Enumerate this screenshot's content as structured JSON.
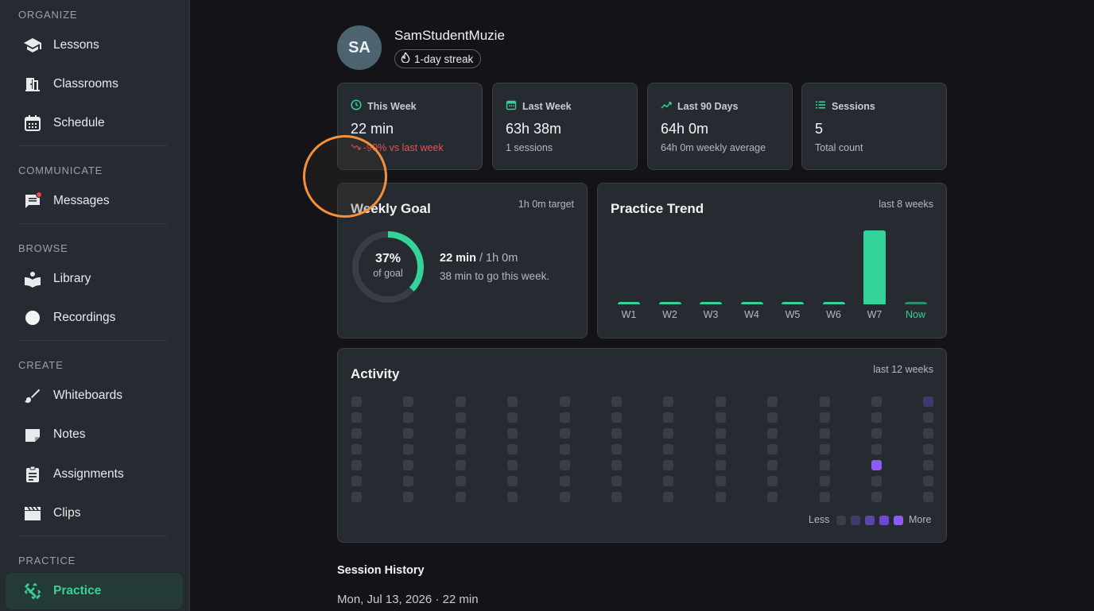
{
  "sidebar": {
    "sections": [
      {
        "title": "ORGANIZE",
        "items": [
          {
            "label": "Lessons",
            "icon": "school-icon"
          },
          {
            "label": "Classrooms",
            "icon": "door-icon"
          },
          {
            "label": "Schedule",
            "icon": "calendar-icon"
          }
        ]
      },
      {
        "title": "COMMUNICATE",
        "items": [
          {
            "label": "Messages",
            "icon": "chat-icon"
          }
        ]
      },
      {
        "title": "BROWSE",
        "items": [
          {
            "label": "Library",
            "icon": "book-icon"
          },
          {
            "label": "Recordings",
            "icon": "record-icon"
          }
        ]
      },
      {
        "title": "CREATE",
        "items": [
          {
            "label": "Whiteboards",
            "icon": "brush-icon"
          },
          {
            "label": "Notes",
            "icon": "note-icon"
          },
          {
            "label": "Assignments",
            "icon": "clipboard-icon"
          },
          {
            "label": "Clips",
            "icon": "clapperboard-icon"
          }
        ]
      },
      {
        "title": "PRACTICE",
        "items": [
          {
            "label": "Practice",
            "icon": "dumbbell-icon",
            "active": true
          }
        ]
      }
    ]
  },
  "profile": {
    "initials": "SA",
    "name": "SamStudentMuzie",
    "streak": "1-day streak"
  },
  "stats": [
    {
      "title": "This Week",
      "value": "22 min",
      "sub": "-90% vs last week",
      "icon": "clock-icon"
    },
    {
      "title": "Last Week",
      "value": "63h 38m",
      "sub": "1 sessions",
      "icon": "calendar-icon"
    },
    {
      "title": "Last 90 Days",
      "value": "64h 0m",
      "sub": "64h 0m weekly average",
      "icon": "trend-up-icon"
    },
    {
      "title": "Sessions",
      "value": "5",
      "sub": "Total count",
      "icon": "list-icon"
    }
  ],
  "weekly_goal": {
    "title": "Weekly Goal",
    "target": "1h 0m target",
    "percent_label": "37%",
    "percent_value": 37,
    "of_goal": "of goal",
    "progress": "22 min",
    "goal": "/ 1h 0m",
    "remaining": "38 min to go this week."
  },
  "practice_trend": {
    "title": "Practice Trend",
    "range": "last 8 weeks",
    "chart_data": {
      "type": "bar",
      "categories": [
        "W1",
        "W2",
        "W3",
        "W4",
        "W5",
        "W6",
        "W7",
        "Now"
      ],
      "values": [
        0,
        0,
        0,
        0,
        0,
        0,
        63.6,
        0.37
      ],
      "ylabel": "",
      "xlabel": ""
    }
  },
  "activity": {
    "title": "Activity",
    "range": "last 12 weeks",
    "weeks": 12,
    "days": 7,
    "highlights": [
      {
        "week": 11,
        "day": 0,
        "level": 1
      },
      {
        "week": 10,
        "day": 4,
        "level": 4
      }
    ],
    "legend_less": "Less",
    "legend_more": "More",
    "colors": [
      "#383d46",
      "#3f3a6e",
      "#5b45a8",
      "#7046d4",
      "#8b5cf6"
    ]
  },
  "history": {
    "title": "Session History",
    "rows": [
      {
        "text": "Mon, Jul 13, 2026 · 22 min"
      }
    ]
  }
}
